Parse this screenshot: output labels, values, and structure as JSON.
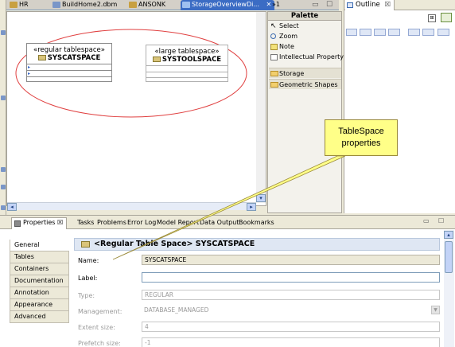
{
  "editor_tabs": [
    {
      "label": "HR",
      "active": false
    },
    {
      "label": "BuildHome2.dbm",
      "active": false
    },
    {
      "label": "ANSONK",
      "active": false
    },
    {
      "label": "StorageOverviewDi...",
      "active": true,
      "close": "✕"
    },
    {
      "label": "»1",
      "active": false
    }
  ],
  "editor_controls": {
    "minimize": "▭",
    "maximize": "☐"
  },
  "diagram": {
    "tablespaces": [
      {
        "stereotype": "«regular tablespace»",
        "name": "SYSCATSPACE"
      },
      {
        "stereotype": "«large tablespace»",
        "name": "SYSTOOLSPACE"
      }
    ]
  },
  "palette": {
    "title": "Palette",
    "items": [
      "Select",
      "Zoom",
      "Note",
      "Intellectual Property"
    ],
    "drawers": [
      "Storage",
      "Geometric Shapes"
    ]
  },
  "outline": {
    "tab_label": "Outline",
    "close": "☒"
  },
  "properties_view": {
    "tabs": [
      "Properties ☒",
      "Tasks",
      "Problems",
      "Error Log",
      "Model Report",
      "Data Output",
      "Bookmarks"
    ],
    "sections": [
      "General",
      "Tables",
      "Containers",
      "Documentation",
      "Annotation",
      "Appearance",
      "Advanced"
    ],
    "title": "<Regular Table Space> SYSCATSPACE",
    "fields": [
      {
        "label": "Name:",
        "value": "SYSCATSPACE"
      },
      {
        "label": "Label:",
        "value": ""
      },
      {
        "label": "Type:",
        "value": "REGULAR"
      },
      {
        "label": "Management:",
        "value": "DATABASE_MANAGED"
      },
      {
        "label": "Extent size:",
        "value": "4"
      },
      {
        "label": "Prefetch size:",
        "value": "-1"
      }
    ]
  },
  "callout": {
    "line1": "TableSpace",
    "line2": "properties"
  },
  "colors": {
    "callout_fill": "#ffff88",
    "ellipse_stroke": "#e04040",
    "active_tab": "#3b6cc4"
  }
}
